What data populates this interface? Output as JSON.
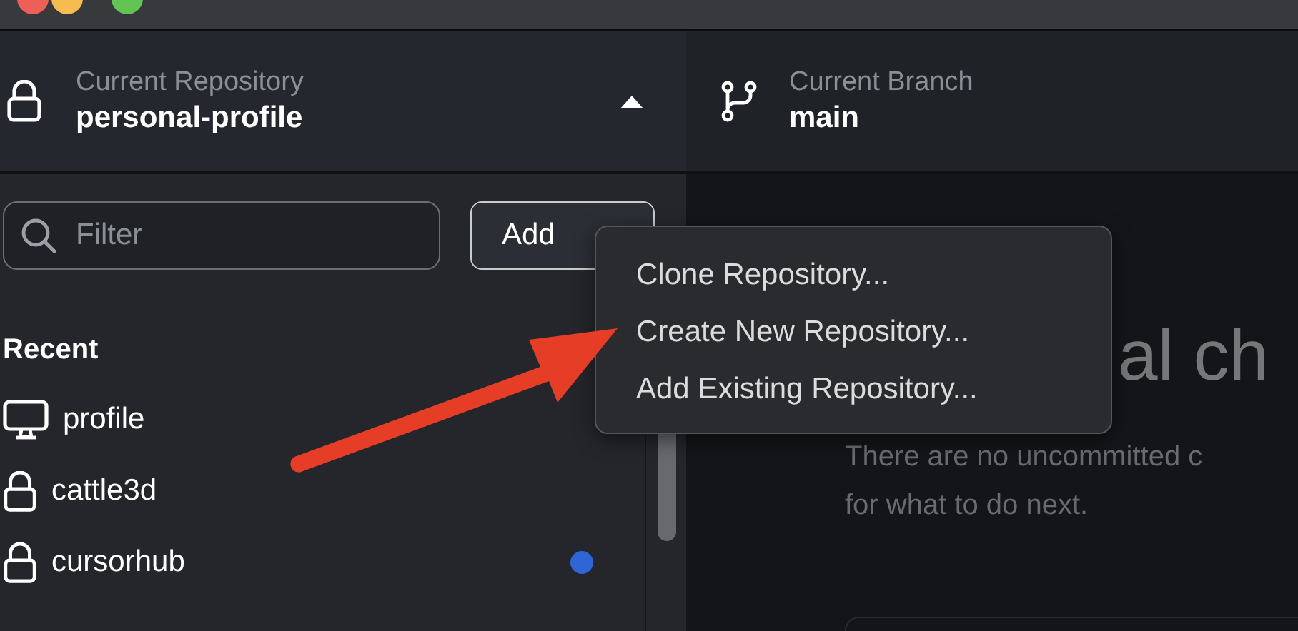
{
  "repository": {
    "label": "Current Repository",
    "name": "personal-profile",
    "expanded": true
  },
  "branch": {
    "label": "Current Branch",
    "name": "main"
  },
  "filter": {
    "placeholder": "Filter"
  },
  "add_button": {
    "label": "Add"
  },
  "add_menu": {
    "items": [
      {
        "label": "Clone Repository..."
      },
      {
        "label": "Create New Repository..."
      },
      {
        "label": "Add Existing Repository..."
      }
    ]
  },
  "recent": {
    "title": "Recent",
    "items": [
      {
        "name": "profile",
        "kind": "desktop",
        "changed": false
      },
      {
        "name": "cattle3d",
        "kind": "lock",
        "changed": false
      },
      {
        "name": "cursorhub",
        "kind": "lock",
        "changed": true
      }
    ]
  },
  "changes": {
    "heading": "al ch",
    "description_lines": [
      "There are no uncommitted c",
      "for what to do next."
    ]
  }
}
